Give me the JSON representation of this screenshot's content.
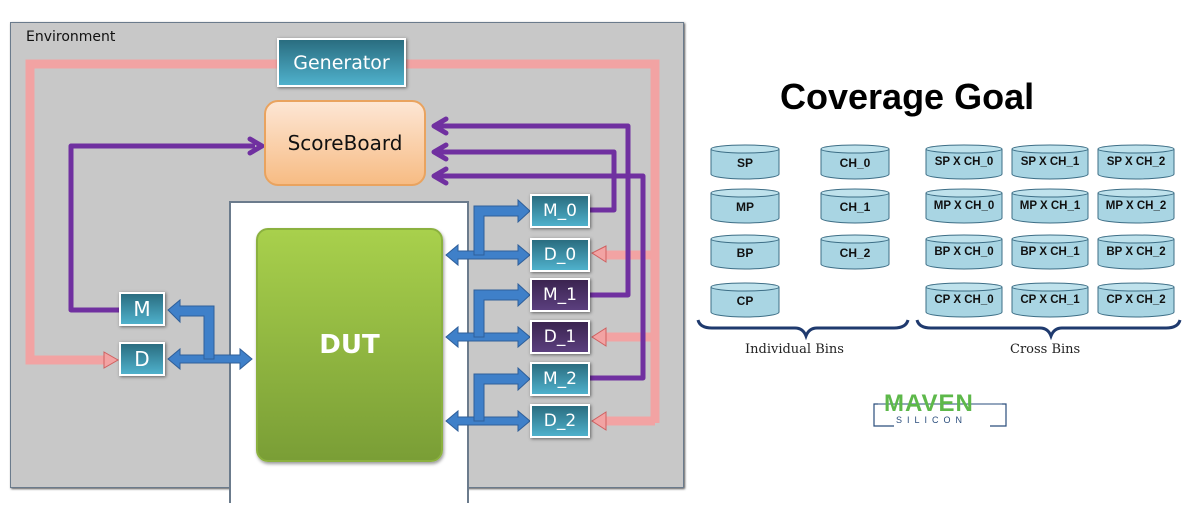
{
  "left_diagram": {
    "environment_label": "Environment",
    "generator": "Generator",
    "scoreboard": "ScoreBoard",
    "dut": "DUT",
    "input_monitor": "M",
    "input_driver": "D",
    "channels": [
      {
        "monitor": "M_0",
        "driver": "D_0",
        "color": "teal"
      },
      {
        "monitor": "M_1",
        "driver": "D_1",
        "color": "purple"
      },
      {
        "monitor": "M_2",
        "driver": "D_2",
        "color": "teal"
      }
    ],
    "colors": {
      "environment_bg": "#c8c8c8",
      "generator_path": "#f0a0a0",
      "monitor_path": "#7030a0",
      "bus_arrow": "#3f7fc8",
      "teal_box": "#3b91a8",
      "purple_box": "#4b3166",
      "dut": "#8fb843",
      "scoreboard": "#f9cfa6"
    }
  },
  "coverage": {
    "title": "Coverage Goal",
    "individual_bins": {
      "label": "Individual Bins",
      "columns": [
        [
          "SP",
          "MP",
          "BP",
          "CP"
        ],
        [
          "CH_0",
          "CH_1",
          "CH_2"
        ]
      ]
    },
    "cross_bins": {
      "label": "Cross Bins",
      "rows": [
        [
          "SP X CH_0",
          "SP X CH_1",
          "SP X CH_2"
        ],
        [
          "MP X CH_0",
          "MP X CH_1",
          "MP X CH_2"
        ],
        [
          "BP X CH_0",
          "BP X CH_1",
          "BP X CH_2"
        ],
        [
          "CP X CH_0",
          "CP X CH_1",
          "CP X CH_2"
        ]
      ]
    },
    "bin_color": "#a9d5e3"
  },
  "logo": {
    "main": "MAVEN",
    "sub": "SILICON"
  }
}
